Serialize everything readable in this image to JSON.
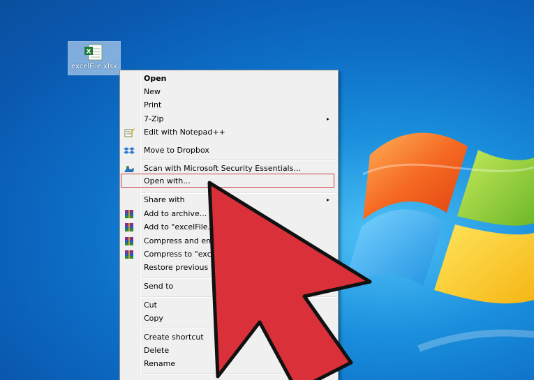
{
  "desktop": {
    "file_icon": {
      "name": "excelFile.xlsx",
      "icon": "excel-file-icon"
    }
  },
  "context_menu": {
    "items": [
      {
        "label": "Open",
        "bold": true
      },
      {
        "label": "New"
      },
      {
        "label": "Print"
      },
      {
        "label": "7-Zip",
        "submenu": true
      },
      {
        "label": "Edit with Notepad++",
        "icon": "notepad-plus-plus-icon"
      },
      {
        "label": "Move to Dropbox",
        "icon": "dropbox-icon"
      },
      {
        "label": "Scan with Microsoft Security Essentials...",
        "icon": "security-essentials-icon"
      },
      {
        "label": "Open with...",
        "highlighted": true
      },
      {
        "label": "Share with",
        "submenu": true
      },
      {
        "label": "Add to archive...",
        "icon": "winrar-icon"
      },
      {
        "label": "Add to \"excelFile.ra",
        "icon": "winrar-icon"
      },
      {
        "label": "Compress and ema",
        "icon": "winrar-icon"
      },
      {
        "label": "Compress to \"excel",
        "icon": "winrar-icon"
      },
      {
        "label": "Restore previous ver"
      },
      {
        "label": "Send to"
      },
      {
        "label": "Cut"
      },
      {
        "label": "Copy"
      },
      {
        "label": "Create shortcut"
      },
      {
        "label": "Delete"
      },
      {
        "label": "Rename"
      }
    ],
    "submenu_arrow": "▸"
  },
  "colors": {
    "highlight_border": "#cc3c3c",
    "cursor_fill": "#d9303a",
    "desktop_blue": "#0d6fc7"
  }
}
